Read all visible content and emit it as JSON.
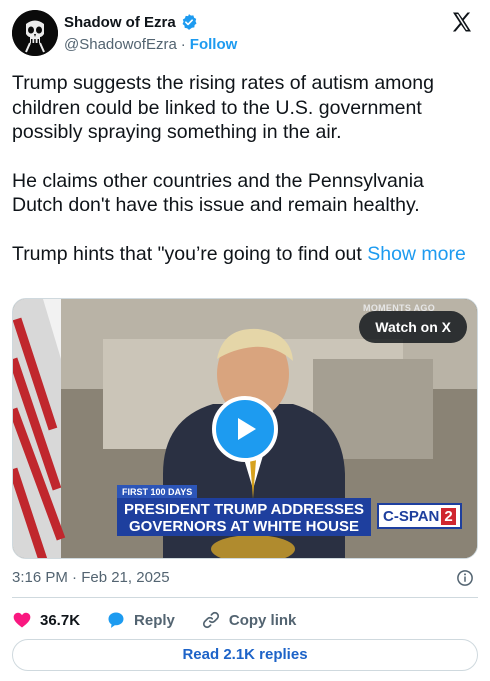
{
  "author": {
    "display_name": "Shadow of Ezra",
    "handle": "@ShadowofEzra",
    "separator": "·",
    "follow_label": "Follow",
    "verified_color": "#1d9bf0",
    "avatar_icon": "skull-avatar-icon"
  },
  "tweet": {
    "paragraph_1": "Trump suggests the rising rates of autism among children could be linked to the U.S. government possibly spraying something in the air.",
    "paragraph_2": "He claims other countries and the Pennsylvania Dutch don't have this issue and remain healthy.",
    "paragraph_3": "Trump hints that \"you’re going to find out",
    "show_more": "Show more"
  },
  "media": {
    "watch_label": "Watch on X",
    "moments_label": "MOMENTS AGO",
    "first100_label": "FIRST 100 DAYS",
    "chyron_line_1": "PRESIDENT TRUMP ADDRESSES",
    "chyron_line_2": "GOVERNORS AT WHITE HOUSE",
    "network_label": "C-SPAN",
    "network_number": "2",
    "play_icon": "play-icon"
  },
  "meta": {
    "timestamp": "3:16 PM · Feb 21, 2025"
  },
  "actions": {
    "likes": "36.7K",
    "reply_label": "Reply",
    "copy_link_label": "Copy link"
  },
  "read_replies_label": "Read 2.1K replies",
  "colors": {
    "accent": "#1d9bf0",
    "like": "#f91880",
    "text_primary": "#0f1419",
    "text_secondary": "#536471",
    "border": "#cfd9de"
  }
}
